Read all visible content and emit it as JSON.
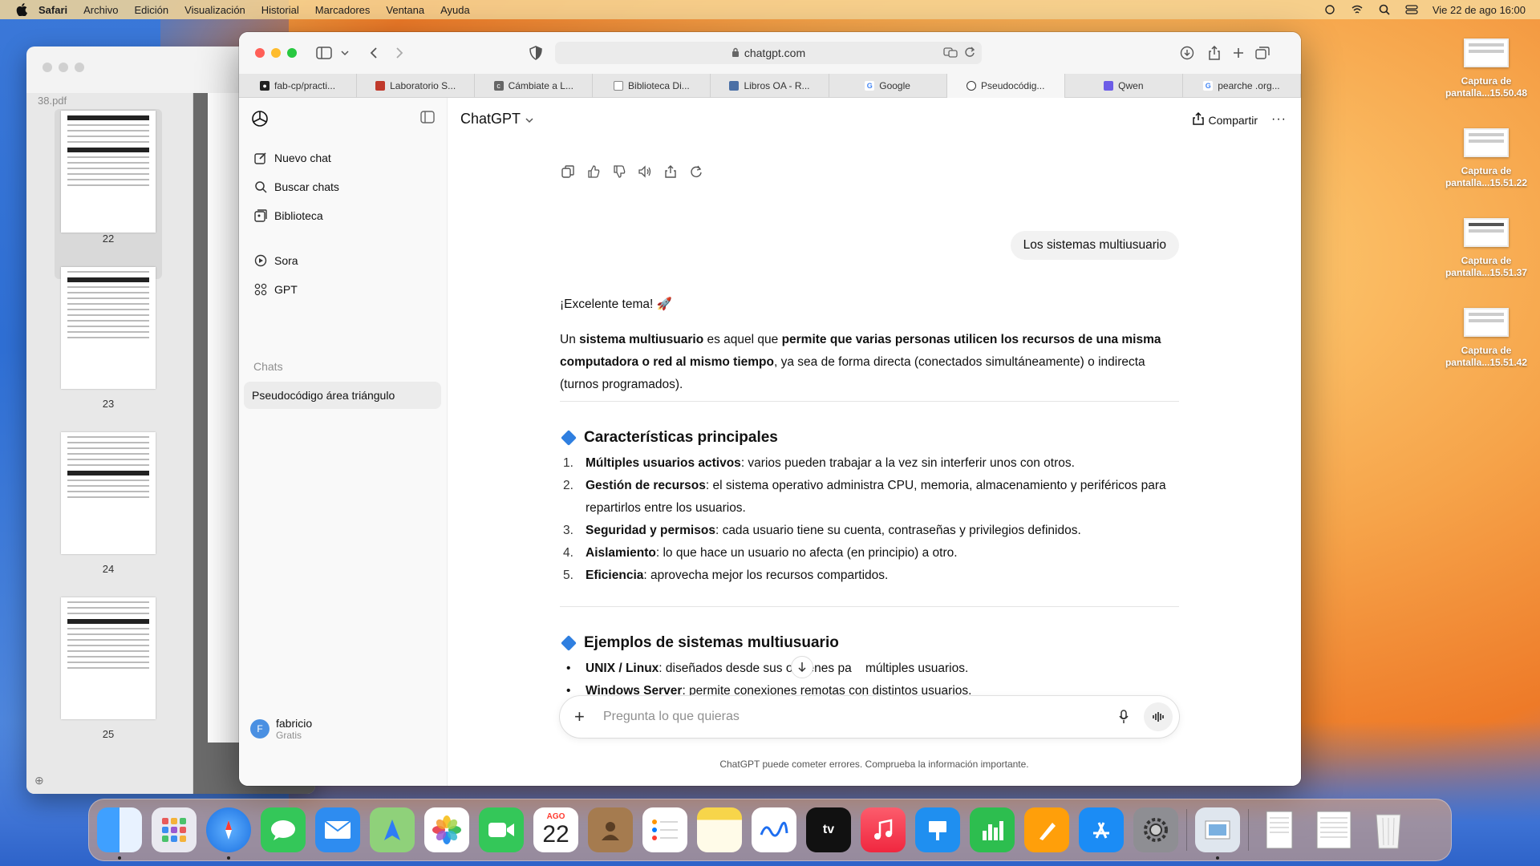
{
  "menubar": {
    "app": "Safari",
    "items": [
      "Archivo",
      "Edición",
      "Visualización",
      "Historial",
      "Marcadores",
      "Ventana",
      "Ayuda"
    ],
    "datetime": "Vie 22 de ago  16:00"
  },
  "desktop": {
    "icons": [
      {
        "label": "Captura de pantalla...15.50.48"
      },
      {
        "label": "Captura de pantalla...15.51.22"
      },
      {
        "label": "Captura de pantalla...15.51.37"
      },
      {
        "label": "Captura de pantalla...15.51.42"
      }
    ]
  },
  "preview": {
    "filename": "38.pdf",
    "pages": [
      "22",
      "23",
      "24",
      "25"
    ]
  },
  "safari": {
    "url": "chatgpt.com",
    "tabs": [
      {
        "label": "fab-cp/practi...",
        "icon": "github-icon"
      },
      {
        "label": "Laboratorio S...",
        "icon": "lab-icon"
      },
      {
        "label": "Cámbiate a L...",
        "icon": "c-icon"
      },
      {
        "label": "Biblioteca Di...",
        "icon": "doc-icon"
      },
      {
        "label": "Libros OA - R...",
        "icon": "books-icon"
      },
      {
        "label": "Google",
        "icon": "google-icon"
      },
      {
        "label": "Pseudocódig...",
        "icon": "openai-icon"
      },
      {
        "label": "Qwen",
        "icon": "qwen-icon"
      },
      {
        "label": "pearche .org...",
        "icon": "google-icon"
      }
    ]
  },
  "chatgpt": {
    "sidebar": {
      "new_chat": "Nuevo chat",
      "search": "Buscar chats",
      "library": "Biblioteca",
      "sora": "Sora",
      "gpt": "GPT",
      "chats_heading": "Chats",
      "active_chat": "Pseudocódigo área triángulo",
      "user_initial": "F",
      "user_name": "fabricio",
      "user_plan": "Gratis"
    },
    "header": {
      "model": "ChatGPT",
      "share": "Compartir"
    },
    "user_message": "Los sistemas multiusuario",
    "answer": {
      "intro": "¡Excelente tema! 🚀",
      "p1_a": "Un ",
      "p1_b": "sistema multiusuario",
      "p1_c": " es aquel que ",
      "p1_d": "permite que varias personas utilicen los recursos de una misma computadora o red al mismo tiempo",
      "p1_e": ", ya sea de forma directa (conectados simultáneamente) o indirecta (turnos programados).",
      "h1": "Características principales",
      "list1": [
        {
          "n": "1.",
          "b": "Múltiples usuarios activos",
          "t": ": varios pueden trabajar a la vez sin interferir unos con otros."
        },
        {
          "n": "2.",
          "b": "Gestión de recursos",
          "t": ": el sistema operativo administra CPU, memoria, almacenamiento y periféricos para repartirlos entre los usuarios."
        },
        {
          "n": "3.",
          "b": "Seguridad y permisos",
          "t": ": cada usuario tiene su cuenta, contraseñas y privilegios definidos."
        },
        {
          "n": "4.",
          "b": "Aislamiento",
          "t": ": lo que hace un usuario no afecta (en principio) a otro."
        },
        {
          "n": "5.",
          "b": "Eficiencia",
          "t": ": aprovecha mejor los recursos compartidos."
        }
      ],
      "h2": "Ejemplos de sistemas multiusuario",
      "list2": [
        {
          "b": "UNIX / Linux",
          "t": ": diseñados desde sus orígenes pa    múltiples usuarios."
        },
        {
          "b": "Windows Server",
          "t": ": permite conexiones remotas con distintos usuarios."
        }
      ]
    },
    "composer_placeholder": "Pregunta lo que quieras",
    "disclaimer": "ChatGPT puede cometer errores. Comprueba la información importante."
  },
  "dock": {
    "calendar_month": "AGO",
    "calendar_day": "22",
    "apps": [
      "Finder",
      "Launchpad",
      "Safari",
      "Mensajes",
      "Mail",
      "Mapas",
      "Fotos",
      "FaceTime",
      "Calendario",
      "Contactos",
      "Recordatorios",
      "Notas",
      "Freeform",
      "TV",
      "Música",
      "Keynote",
      "Numbers",
      "Pages",
      "App Store",
      "Configuración",
      "Vista Previa",
      "Documento",
      "Documento PDF",
      "Papelera"
    ]
  }
}
